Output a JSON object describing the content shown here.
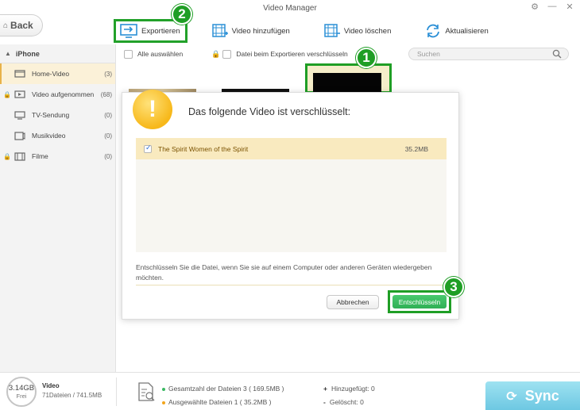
{
  "window": {
    "title": "Video Manager"
  },
  "back": {
    "label": "Back"
  },
  "toolbar": {
    "export": "Exportieren",
    "add_video": "Video hinzufügen",
    "delete_video": "Video löschen",
    "refresh": "Aktualisieren"
  },
  "annotations": [
    "1",
    "2",
    "3"
  ],
  "sidebar": {
    "device": "iPhone",
    "items": [
      {
        "label": "Home-Video",
        "count": "(3)",
        "active": true,
        "locked": false,
        "icon": "home-video-icon"
      },
      {
        "label": "Video aufgenommen",
        "count": "(68)",
        "active": false,
        "locked": true,
        "icon": "camera-icon"
      },
      {
        "label": "TV-Sendung",
        "count": "(0)",
        "active": false,
        "locked": false,
        "icon": "tv-icon"
      },
      {
        "label": "Musikvideo",
        "count": "(0)",
        "active": false,
        "locked": false,
        "icon": "music-video-icon"
      },
      {
        "label": "Filme",
        "count": "(0)",
        "active": false,
        "locked": true,
        "icon": "film-icon"
      }
    ]
  },
  "list": {
    "select_all": "Alle auswählen",
    "encrypt_on_export": "Datei beim Exportieren verschlüsseln",
    "search_placeholder": "Suchen"
  },
  "dialog": {
    "title": "Das folgende Video ist verschlüsselt:",
    "items": [
      {
        "name": "The Spirit Women of the Spirit",
        "size": "35.2MB",
        "checked": true
      }
    ],
    "note": "Entschlüsseln Sie die Datei, wenn Sie sie auf einem Computer oder anderen Geräten wiedergeben möchten.",
    "cancel": "Abbrechen",
    "decrypt": "Entschlüsseln"
  },
  "footer": {
    "capacity": "3.14GB",
    "free": "Frei",
    "category": "Video",
    "category_summary": "71Dateien / 741.5MB",
    "total_files": "Gesamtzahl der Dateien 3 ( 169.5MB )",
    "selected_files": "Ausgewählte Dateien 1 ( 35.2MB )",
    "added_symbol": "+",
    "added": "Hinzugefügt: 0",
    "deleted_symbol": "-",
    "deleted": "Gelöscht: 0",
    "sync": "Sync"
  },
  "colors": {
    "highlight_green": "#1f9e25",
    "active_row": "#fbf1d8",
    "dialog_row": "#f9eabf",
    "decrypt_button": "#3ab862",
    "sync_button": "#86d5ea",
    "warning": "#f7b81a"
  }
}
